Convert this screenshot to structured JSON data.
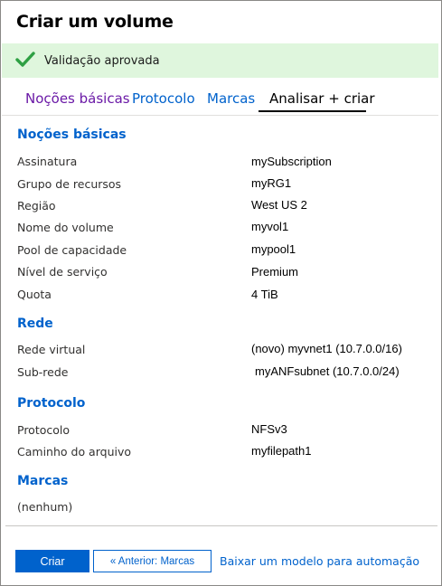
{
  "window": {
    "title": "Criar um volume"
  },
  "banner": {
    "message": "Validação aprovada",
    "icon": "check-icon",
    "color": "#dff6dd",
    "check_color": "#2ea043"
  },
  "tabs": [
    {
      "label": "Noções básicas"
    },
    {
      "label": "Protocolo"
    },
    {
      "label": "Marcas"
    },
    {
      "label": "Analisar + criar"
    }
  ],
  "sections": {
    "basics": {
      "title": "Noções básicas",
      "rows": [
        {
          "label": "Assinatura",
          "value": "mySubscription"
        },
        {
          "label": "Grupo de recursos",
          "value": "myRG1"
        },
        {
          "label": "Região",
          "value": "West US 2"
        },
        {
          "label": "Nome do volume",
          "value": "myvol1"
        },
        {
          "label": "Pool de capacidade",
          "value": "mypool1"
        },
        {
          "label": "Nível de serviço",
          "value": "Premium"
        },
        {
          "label": "Quota",
          "value": "4 TiB"
        }
      ]
    },
    "network": {
      "title": "Rede",
      "rows": [
        {
          "label": "Rede virtual",
          "value": "(novo) myvnet1 (10.7.0.0/16)"
        },
        {
          "label": "Sub-rede",
          "value": "myANFsubnet (10.7.0.0/24)"
        }
      ]
    },
    "protocol": {
      "title": "Protocolo",
      "rows": [
        {
          "label": "Protocolo",
          "value": "NFSv3"
        },
        {
          "label": "Caminho do arquivo",
          "value": "myfilepath1"
        }
      ]
    },
    "tags": {
      "title": "Marcas",
      "rows": [
        {
          "label": "(nenhum)"
        }
      ]
    }
  },
  "footer": {
    "create_label": "Criar",
    "previous_label": "« Anterior: Marcas",
    "automation_link": "Baixar um modelo para automação"
  },
  "colors": {
    "accent": "#0062cc",
    "visited": "#6b1aa7"
  }
}
